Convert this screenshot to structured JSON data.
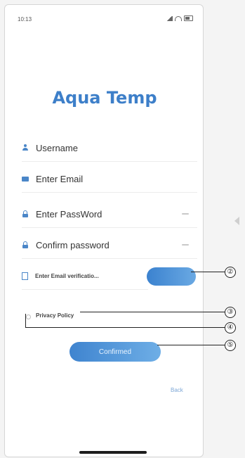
{
  "status_bar": {
    "time": "10:13"
  },
  "app": {
    "title": "Aqua Temp"
  },
  "form": {
    "username_placeholder": "Username",
    "email_placeholder": "Enter Email",
    "password_placeholder": "Enter PassWord",
    "confirm_password_placeholder": "Confirm password",
    "verification_placeholder": "Enter Email verificatio...",
    "send_code_label": "",
    "privacy_label": "Privacy Policy",
    "confirm_label": "Confirmed",
    "back_label": "Back"
  },
  "callouts": [
    "②",
    "③",
    "④",
    "⑤"
  ],
  "colors": {
    "brand": "#3d7fc9",
    "button_start": "#3f84cf",
    "button_end": "#6eaee6"
  },
  "icons": [
    "user-icon",
    "mail-icon",
    "lock-icon",
    "lock-icon",
    "document-icon",
    "eye-icon"
  ]
}
